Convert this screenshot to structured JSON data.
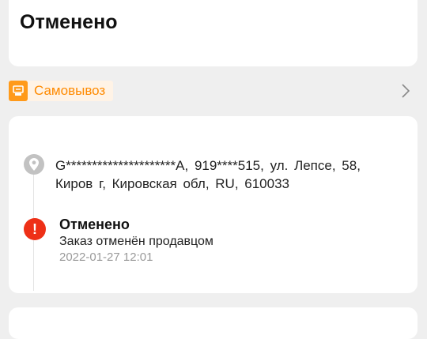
{
  "status_card": {
    "title": "Отменено"
  },
  "pickup": {
    "label": "Самовывоз",
    "icon": "pickup-point-icon",
    "accent": "#ff8a00"
  },
  "delivery": {
    "address": "G*********************A, 919****515, ул. Лепсе, 58, Киров г, Кировская обл, RU, 610033",
    "pin_icon": "location-pin-icon",
    "event": {
      "icon": "alert-icon",
      "icon_glyph": "!",
      "title": "Отменено",
      "description": "Заказ отменён продавцом",
      "timestamp": "2022-01-27 12:01",
      "color": "#ee3017"
    }
  }
}
